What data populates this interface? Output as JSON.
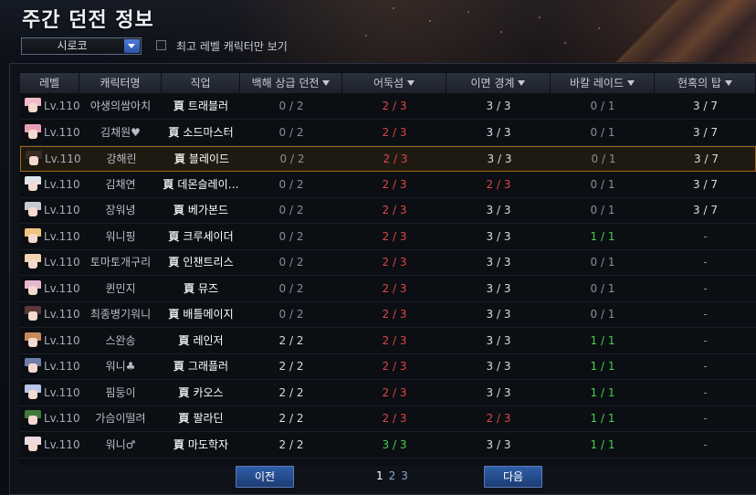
{
  "title": "주간 던전 정보",
  "server_select": {
    "value": "시로코"
  },
  "max_level_filter": {
    "label": "최고 레벨 캐릭터만 보기",
    "checked": false
  },
  "columns": [
    {
      "label": "레벨"
    },
    {
      "label": "캐릭터명"
    },
    {
      "label": "직업"
    },
    {
      "label": "백해 상급 던전",
      "sort": true
    },
    {
      "label": "어둑섬",
      "sort": true
    },
    {
      "label": "이면 경계",
      "sort": true
    },
    {
      "label": "바칼 레이드",
      "sort": true
    },
    {
      "label": "현혹의 탑",
      "sort": true
    }
  ],
  "job_mark": "頁",
  "colors": {
    "red": "#e04545",
    "green": "#43d24b",
    "white": "#d9dce2",
    "gray": "#8a8f98",
    "selected_border": "#9d6a18",
    "button": "#2f5ea8"
  },
  "rows": [
    {
      "level": "Lv.110",
      "name": "야생의쌈아치",
      "job": "트래블러",
      "cols": [
        "0 / 2",
        "2 / 3",
        "3 / 3",
        "0 / 1",
        "3 / 7"
      ],
      "colors": [
        "g",
        "r",
        "w",
        "g",
        "w"
      ],
      "hair": "#f2b8c9",
      "selected": false
    },
    {
      "level": "Lv.110",
      "name": "김채원♥",
      "job": "소드마스터",
      "cols": [
        "0 / 2",
        "2 / 3",
        "3 / 3",
        "0 / 1",
        "3 / 7"
      ],
      "colors": [
        "g",
        "r",
        "w",
        "g",
        "w"
      ],
      "hair": "#e9a0b6",
      "selected": false
    },
    {
      "level": "Lv.110",
      "name": "강해린",
      "job": "블레이드",
      "cols": [
        "0 / 2",
        "2 / 3",
        "3 / 3",
        "0 / 1",
        "3 / 7"
      ],
      "colors": [
        "g",
        "r",
        "w",
        "g",
        "w"
      ],
      "hair": "#3a2a26",
      "selected": true
    },
    {
      "level": "Lv.110",
      "name": "김채연",
      "job": "데몬슬레이…",
      "cols": [
        "0 / 2",
        "2 / 3",
        "2 / 3",
        "0 / 1",
        "3 / 7"
      ],
      "colors": [
        "g",
        "r",
        "r",
        "g",
        "w"
      ],
      "hair": "#dfe3ea",
      "selected": false
    },
    {
      "level": "Lv.110",
      "name": "장워녕",
      "job": "베가본드",
      "cols": [
        "0 / 2",
        "2 / 3",
        "3 / 3",
        "0 / 1",
        "3 / 7"
      ],
      "colors": [
        "g",
        "r",
        "w",
        "g",
        "w"
      ],
      "hair": "#c7c9d6",
      "selected": false
    },
    {
      "level": "Lv.110",
      "name": "워니핑",
      "job": "크루세이더",
      "cols": [
        "0 / 2",
        "2 / 3",
        "3 / 3",
        "1 / 1",
        "-"
      ],
      "colors": [
        "g",
        "r",
        "w",
        "gr",
        "dash"
      ],
      "hair": "#f0c37a",
      "selected": false
    },
    {
      "level": "Lv.110",
      "name": "토마토개구리",
      "job": "인챈트리스",
      "cols": [
        "0 / 2",
        "2 / 3",
        "3 / 3",
        "0 / 1",
        "-"
      ],
      "colors": [
        "g",
        "r",
        "w",
        "g",
        "dash"
      ],
      "hair": "#f3d3b0",
      "selected": false
    },
    {
      "level": "Lv.110",
      "name": "퀸민지",
      "job": "뮤즈",
      "cols": [
        "0 / 2",
        "2 / 3",
        "3 / 3",
        "0 / 1",
        "-"
      ],
      "colors": [
        "g",
        "r",
        "w",
        "g",
        "dash"
      ],
      "hair": "#e7b7cf",
      "selected": false
    },
    {
      "level": "Lv.110",
      "name": "최종병기워니",
      "job": "배틀메이지",
      "cols": [
        "0 / 2",
        "2 / 3",
        "3 / 3",
        "0 / 1",
        "-"
      ],
      "colors": [
        "g",
        "r",
        "w",
        "g",
        "dash"
      ],
      "hair": "#5a3a38",
      "selected": false
    },
    {
      "level": "Lv.110",
      "name": "스완송",
      "job": "레인저",
      "cols": [
        "2 / 2",
        "2 / 3",
        "3 / 3",
        "1 / 1",
        "-"
      ],
      "colors": [
        "w",
        "r",
        "w",
        "gr",
        "dash"
      ],
      "hair": "#c98a5a",
      "selected": false
    },
    {
      "level": "Lv.110",
      "name": "워니♣",
      "job": "그래플러",
      "cols": [
        "2 / 2",
        "2 / 3",
        "3 / 3",
        "1 / 1",
        "-"
      ],
      "colors": [
        "w",
        "r",
        "w",
        "gr",
        "dash"
      ],
      "hair": "#6d7fa8",
      "selected": false
    },
    {
      "level": "Lv.110",
      "name": "핌둥이",
      "job": "카오스",
      "cols": [
        "2 / 2",
        "2 / 3",
        "3 / 3",
        "1 / 1",
        "-"
      ],
      "colors": [
        "w",
        "r",
        "w",
        "gr",
        "dash"
      ],
      "hair": "#b9c4e8",
      "selected": false
    },
    {
      "level": "Lv.110",
      "name": "가슴이떨려",
      "job": "팔라딘",
      "cols": [
        "2 / 2",
        "2 / 3",
        "2 / 3",
        "1 / 1",
        "-"
      ],
      "colors": [
        "w",
        "r",
        "r",
        "gr",
        "dash"
      ],
      "hair": "#3f7a3a",
      "selected": false
    },
    {
      "level": "Lv.110",
      "name": "워니♂",
      "job": "마도학자",
      "cols": [
        "2 / 2",
        "3 / 3",
        "3 / 3",
        "1 / 1",
        "-"
      ],
      "colors": [
        "w",
        "gr",
        "w",
        "gr",
        "dash"
      ],
      "hair": "#efd9e3",
      "selected": false
    }
  ],
  "pagination": {
    "prev": "이전",
    "next": "다음",
    "pages": [
      "1",
      "2",
      "3"
    ],
    "current": "1"
  }
}
